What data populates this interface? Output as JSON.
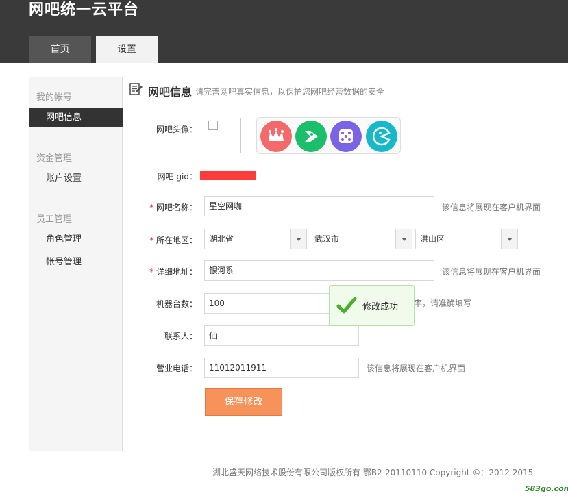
{
  "app": {
    "title": "网吧统一云平台"
  },
  "tabs": [
    {
      "label": "首页"
    },
    {
      "label": "设置"
    }
  ],
  "sidebar": {
    "groups": [
      {
        "title": "我的帐号",
        "items": [
          {
            "label": "网吧信息",
            "active": true
          }
        ]
      },
      {
        "title": "资金管理",
        "items": [
          {
            "label": "账户设置"
          }
        ]
      },
      {
        "title": "员工管理",
        "items": [
          {
            "label": "角色管理"
          },
          {
            "label": "帐号管理"
          }
        ]
      }
    ]
  },
  "content": {
    "title": "网吧信息",
    "subtitle": "请完善网吧真实信息，以保护您网吧经营数据的安全"
  },
  "form": {
    "avatar_label": "网吧头像：",
    "gid_label": "网吧 gid：",
    "name_label": "网吧名称：",
    "name_value": "星空网咖",
    "name_hint": "该信息将展现在客户机界面",
    "region_label": "所在地区：",
    "province": "湖北省",
    "city": "武汉市",
    "district": "洪山区",
    "address_label": "详细地址：",
    "address_value": "银河系",
    "address_hint": "该信息将展现在客户机界面",
    "machines_label": "机器台数：",
    "machines_value": "100",
    "machines_hint": "率，请准确填写",
    "contact_label": "联系人：",
    "contact_value": "仙",
    "phone_label": "营业电话：",
    "phone_value": "11012011911",
    "phone_hint": "该信息将展现在客户机界面",
    "required_mark": "*",
    "save_label": "保存修改"
  },
  "avatars": [
    {
      "icon": "crown-icon",
      "color": "#f46a6a"
    },
    {
      "icon": "play-icon",
      "color": "#1bbf6b"
    },
    {
      "icon": "dice-icon",
      "color": "#7b63e6"
    },
    {
      "icon": "pacman-icon",
      "color": "#17b8c8"
    }
  ],
  "toast": {
    "message": "修改成功",
    "icon": "check-icon",
    "color": "#4caf2a"
  },
  "footer": {
    "copyright": "湖北盛天网络技术股份有限公司版权所有 鄂B2-20110110 Copyright ©：2012   2015"
  },
  "watermark": {
    "text": "583go.com"
  }
}
